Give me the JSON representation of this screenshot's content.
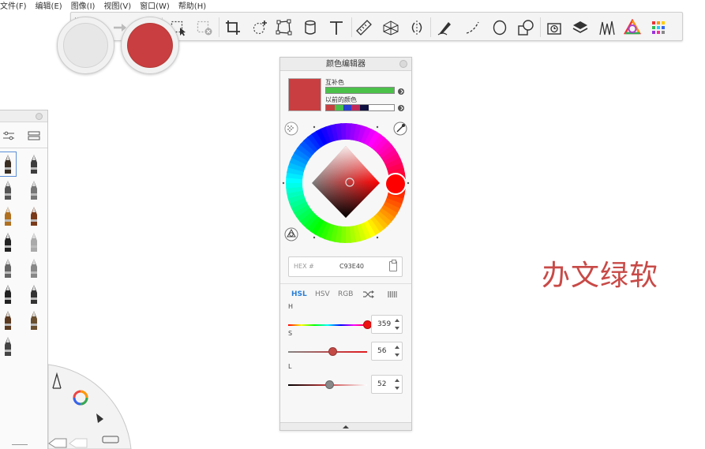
{
  "menubar": {
    "items": [
      "文件(F)",
      "编辑(E)",
      "图像(I)",
      "视图(V)",
      "窗口(W)",
      "帮助(H)"
    ]
  },
  "toolbar": {
    "tools": [
      "undo-icon",
      "redo-icon",
      "zoom-icon",
      "select-icon",
      "clear-selection-icon",
      "crop-icon",
      "transform-icon",
      "distort-icon",
      "fill-icon",
      "text-icon",
      "ruler-icon",
      "perspective-icon",
      "symmetry-icon",
      "stroke-icon",
      "curve-icon",
      "ellipse-icon",
      "shapes-icon",
      "timelapse-icon",
      "layers-icon",
      "brush-library-icon",
      "color-wheel-icon",
      "color-palette-icon"
    ]
  },
  "pucks": {
    "left_color": "#e7e7e7",
    "right_color": "#c93e40"
  },
  "color_editor": {
    "title": "颜色编辑器",
    "current_color": "#c93e40",
    "complement_label": "互补色",
    "complement_color": "#4bc14a",
    "previous_label": "以前的颜色",
    "previous_colors": [
      "#c93e40",
      "#4bc14a",
      "#2a40d0",
      "#c0285a",
      "#101040",
      "#ffffff",
      "#ffffff",
      "#ffffff"
    ],
    "hex_label": "HEX #",
    "hex_value": "C93E40",
    "modes": [
      "HSL",
      "HSV",
      "RGB"
    ],
    "active_mode": "HSL",
    "sliders": [
      {
        "label": "H",
        "value": "359",
        "fraction": 0.997
      },
      {
        "label": "S",
        "value": "56",
        "fraction": 0.56
      },
      {
        "label": "L",
        "value": "52",
        "fraction": 0.52
      }
    ]
  },
  "watermark": {
    "text": "办文绿软"
  }
}
